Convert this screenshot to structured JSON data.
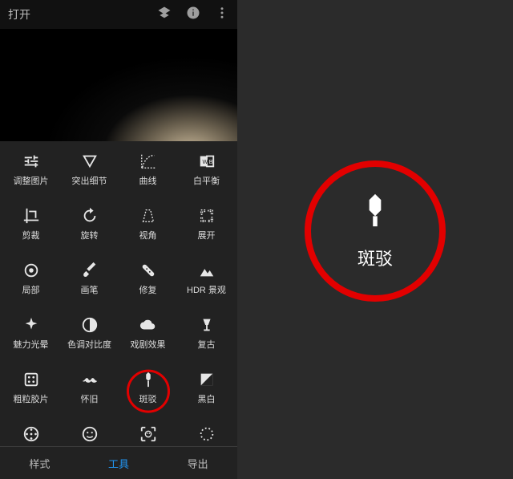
{
  "topbar": {
    "open": "打开"
  },
  "tools": [
    {
      "name": "tune",
      "label": "调整图片"
    },
    {
      "name": "details",
      "label": "突出细节"
    },
    {
      "name": "curves",
      "label": "曲线"
    },
    {
      "name": "white-balance",
      "label": "白平衡"
    },
    {
      "name": "crop",
      "label": "剪裁"
    },
    {
      "name": "rotate",
      "label": "旋转"
    },
    {
      "name": "perspective",
      "label": "视角"
    },
    {
      "name": "expand",
      "label": "展开"
    },
    {
      "name": "selective",
      "label": "局部"
    },
    {
      "name": "brush",
      "label": "画笔"
    },
    {
      "name": "healing",
      "label": "修复"
    },
    {
      "name": "hdr",
      "label": "HDR 景观"
    },
    {
      "name": "glamour",
      "label": "魅力光晕"
    },
    {
      "name": "tonal-contrast",
      "label": "色调对比度"
    },
    {
      "name": "drama",
      "label": "戏剧效果"
    },
    {
      "name": "vintage",
      "label": "复古"
    },
    {
      "name": "grainy-film",
      "label": "粗粒胶片"
    },
    {
      "name": "retrolux",
      "label": "怀旧"
    },
    {
      "name": "grunge",
      "label": "斑驳"
    },
    {
      "name": "bw",
      "label": "黑白"
    },
    {
      "name": "film-reel",
      "label": ""
    },
    {
      "name": "face-enhance",
      "label": ""
    },
    {
      "name": "face-pose",
      "label": ""
    },
    {
      "name": "more",
      "label": ""
    }
  ],
  "tabs": {
    "styles": "样式",
    "tools": "工具",
    "export": "导出"
  },
  "highlight": {
    "label": "斑驳"
  }
}
